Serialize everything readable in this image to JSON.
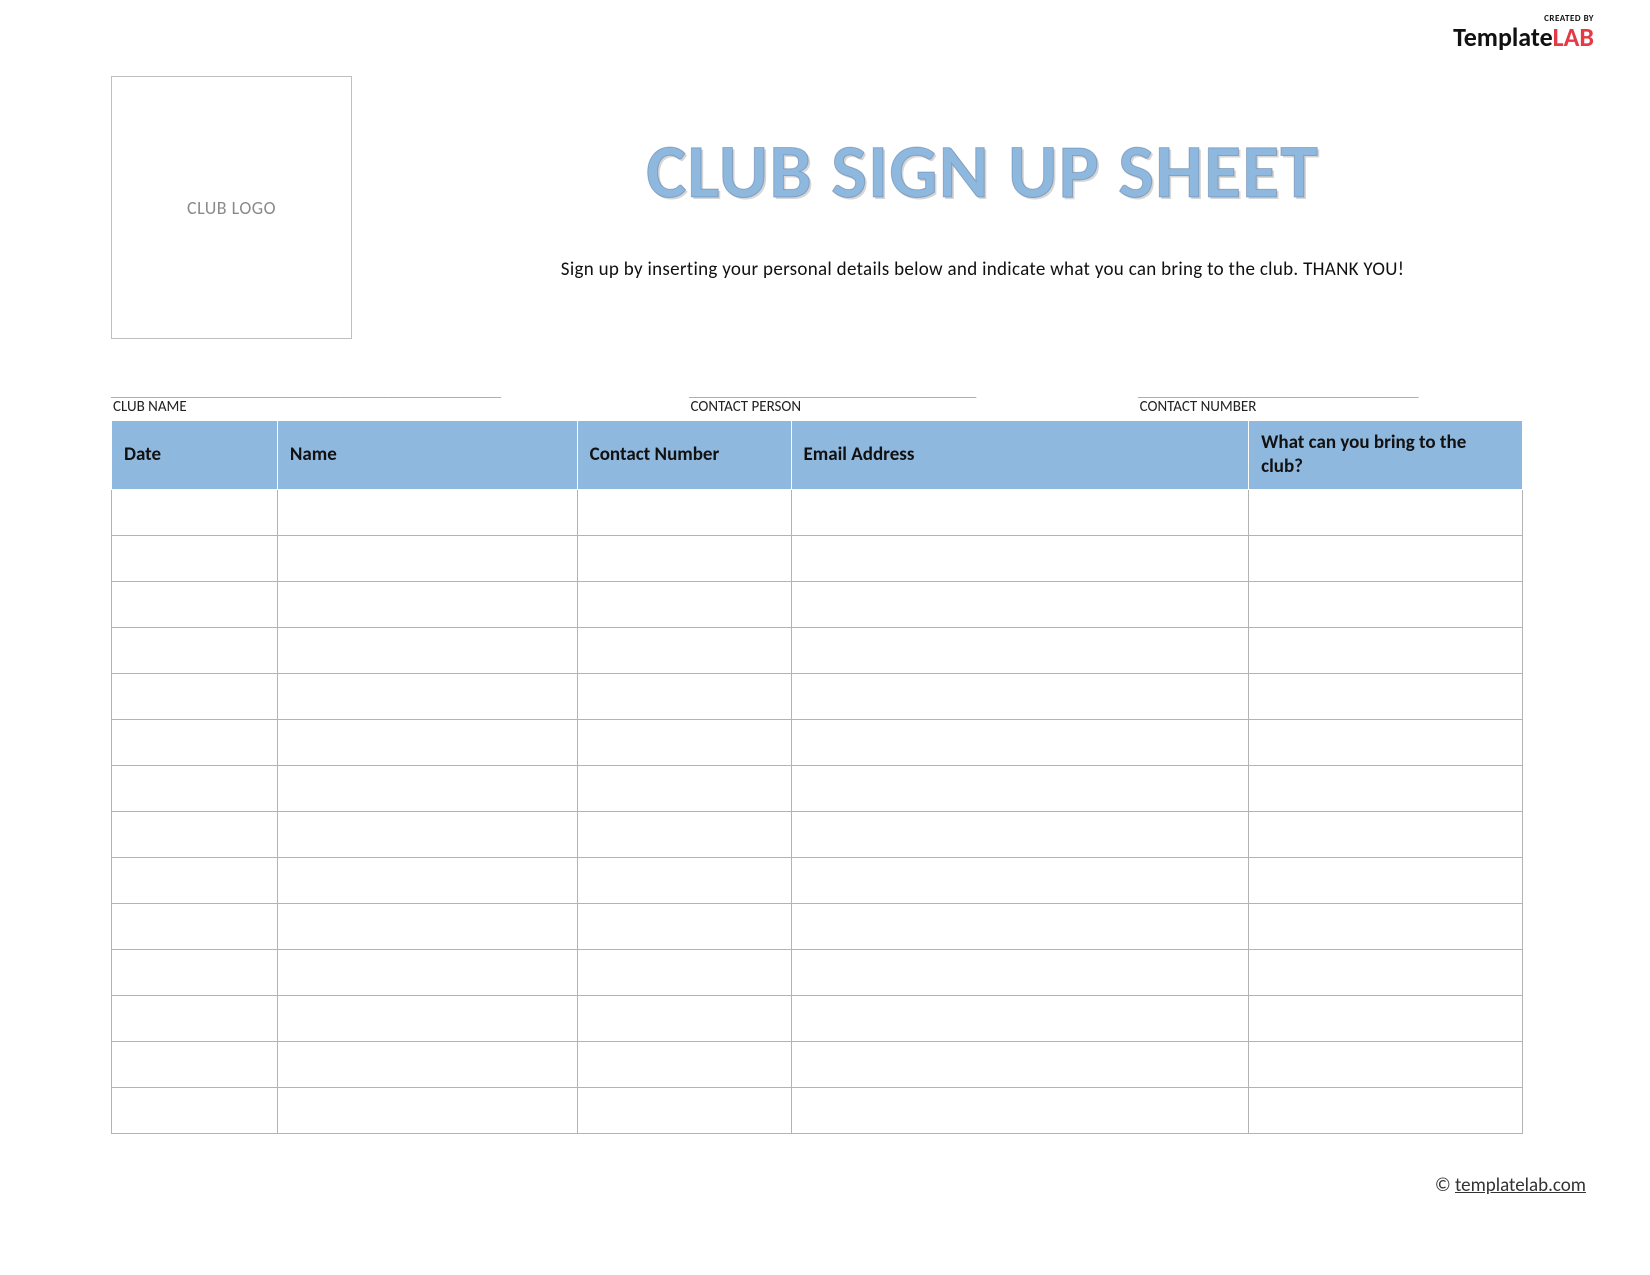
{
  "brand": {
    "created_by": "CREATED BY",
    "name_pre": "Template",
    "name_lab": "LAB"
  },
  "logo_placeholder": "CLUB LOGO",
  "title": "CLUB SIGN UP SHEET",
  "subtitle": "Sign up by inserting your personal details below and indicate what you can bring to the club. THANK YOU!",
  "meta": {
    "club_name_label": "CLUB NAME",
    "contact_person_label": "CONTACT PERSON",
    "contact_number_label": "CONTACT NUMBER"
  },
  "columns": {
    "date": "Date",
    "name": "Name",
    "contact": "Contact Number",
    "email": "Email Address",
    "bring": "What can you bring to the club?"
  },
  "row_count": 14,
  "footer": {
    "copyright": "©",
    "link_text": "templatelab.com"
  }
}
